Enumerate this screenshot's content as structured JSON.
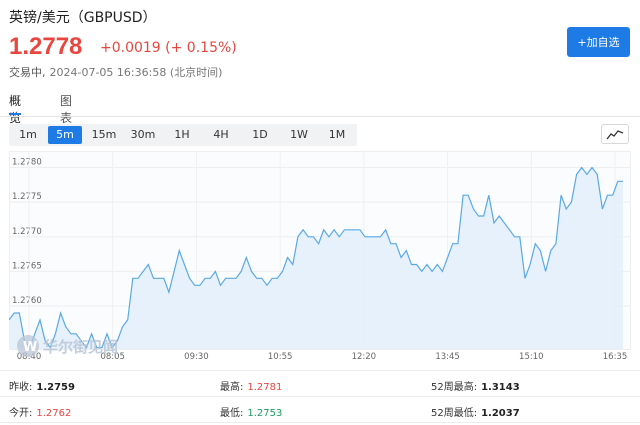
{
  "header": {
    "title": "英镑/美元（GBPUSD）",
    "price": "1.2778",
    "change": "+0.0019 (+ 0.15%)",
    "status": "交易中,",
    "timestamp": "2024-07-05 16:36:58 (北京时间)",
    "add_watchlist_label": "+加自选"
  },
  "tabs": [
    {
      "label": "概览",
      "active": true
    },
    {
      "label": "图表",
      "active": false
    }
  ],
  "periods": [
    {
      "label": "1m",
      "active": false
    },
    {
      "label": "5m",
      "active": true
    },
    {
      "label": "15m",
      "active": false
    },
    {
      "label": "30m",
      "active": false
    },
    {
      "label": "1H",
      "active": false
    },
    {
      "label": "4H",
      "active": false
    },
    {
      "label": "1D",
      "active": false
    },
    {
      "label": "1W",
      "active": false
    },
    {
      "label": "1M",
      "active": false
    }
  ],
  "watermark": "华尔街见闻",
  "colors": {
    "accent": "#1e7be6",
    "up": "#e8463f",
    "down": "#1a9c5a",
    "line": "#5aa9e6",
    "area": "#e3f0fb"
  },
  "chart_data": {
    "type": "area",
    "x_tick_labels": [
      "08:40",
      "08:05",
      "09:30",
      "10:55",
      "12:20",
      "13:45",
      "15:10",
      "16:35"
    ],
    "y_tick_labels": [
      "1.2760",
      "1.2765",
      "1.2770",
      "1.2775",
      "1.2780"
    ],
    "ylim": [
      1.27538,
      1.27818
    ],
    "grid": true,
    "values": [
      1.2758,
      1.2759,
      1.2759,
      1.2755,
      1.2754,
      1.2756,
      1.2758,
      1.2755,
      1.2754,
      1.2756,
      1.2759,
      1.2757,
      1.2756,
      1.2756,
      1.2755,
      1.2754,
      1.2756,
      1.2754,
      1.2754,
      1.2756,
      1.2754,
      1.2755,
      1.2757,
      1.2758,
      1.2764,
      1.2764,
      1.2765,
      1.2766,
      1.2764,
      1.2764,
      1.2764,
      1.2762,
      1.2765,
      1.2768,
      1.2766,
      1.2764,
      1.2763,
      1.2763,
      1.2764,
      1.2764,
      1.2765,
      1.2763,
      1.2764,
      1.2764,
      1.2764,
      1.2765,
      1.2767,
      1.2765,
      1.2764,
      1.2764,
      1.2763,
      1.2764,
      1.2764,
      1.2765,
      1.2767,
      1.2766,
      1.277,
      1.2771,
      1.277,
      1.277,
      1.2769,
      1.2771,
      1.277,
      1.2771,
      1.277,
      1.2771,
      1.2771,
      1.2771,
      1.2771,
      1.277,
      1.277,
      1.277,
      1.277,
      1.2771,
      1.2769,
      1.2769,
      1.2767,
      1.2768,
      1.2766,
      1.2766,
      1.2765,
      1.2766,
      1.2765,
      1.2766,
      1.2765,
      1.2767,
      1.2769,
      1.2769,
      1.2776,
      1.2776,
      1.2774,
      1.2773,
      1.2773,
      1.2776,
      1.2772,
      1.2773,
      1.2772,
      1.2771,
      1.277,
      1.277,
      1.2764,
      1.2766,
      1.2769,
      1.2768,
      1.2765,
      1.2768,
      1.2769,
      1.2776,
      1.2774,
      1.2775,
      1.2779,
      1.278,
      1.2779,
      1.278,
      1.2779,
      1.2774,
      1.2776,
      1.2776,
      1.2778,
      1.2778
    ]
  },
  "stats": [
    {
      "label": "昨收:",
      "value": "1.2759",
      "tone": "dark"
    },
    {
      "label": "最高:",
      "value": "1.2781",
      "tone": "red"
    },
    {
      "label": "52周最高:",
      "value": "1.3143",
      "tone": "dark"
    },
    {
      "label": "今开:",
      "value": "1.2762",
      "tone": "red"
    },
    {
      "label": "最低:",
      "value": "1.2753",
      "tone": "green"
    },
    {
      "label": "52周最低:",
      "value": "1.2037",
      "tone": "dark"
    }
  ]
}
